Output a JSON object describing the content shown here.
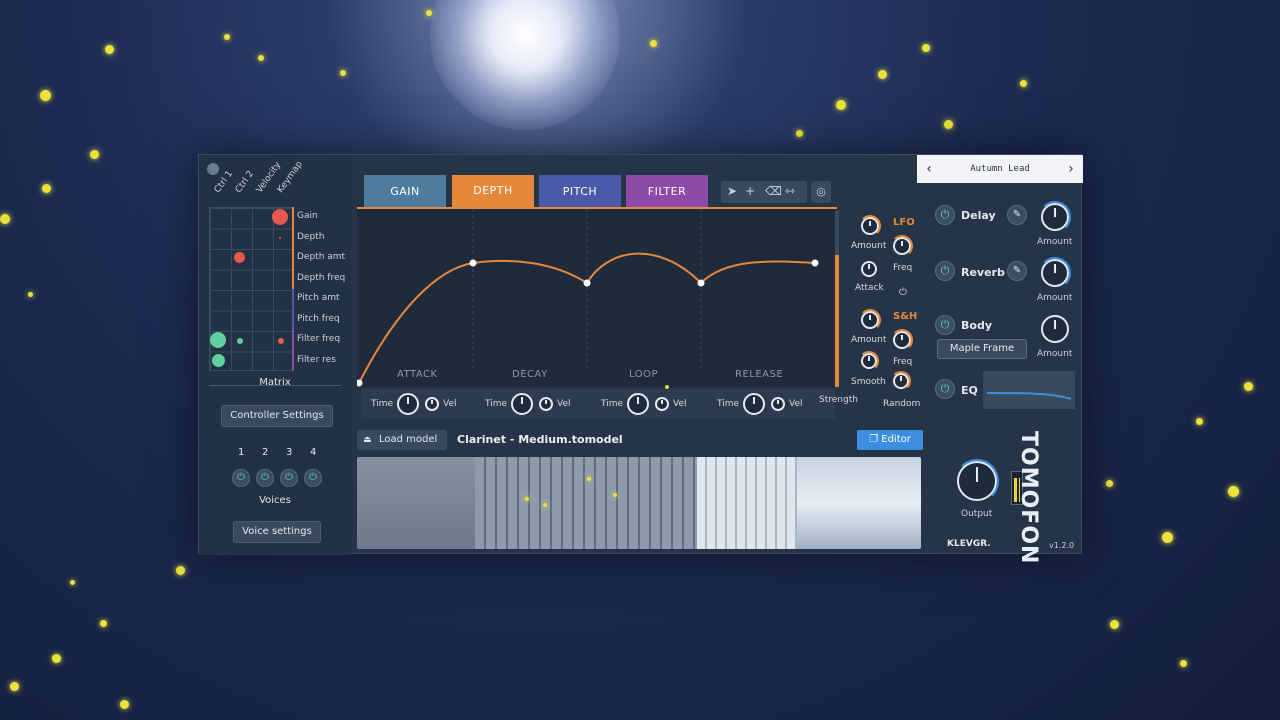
{
  "preset": {
    "name": "Autumn Lead"
  },
  "matrix": {
    "columns": [
      "Ctrl 1",
      "Ctrl 2",
      "Velocity",
      "Keymap"
    ],
    "rows": [
      "Gain",
      "Depth",
      "Depth amt",
      "Depth freq",
      "Pitch amt",
      "Pitch freq",
      "Filter freq",
      "Filter res"
    ],
    "title": "Matrix"
  },
  "controller_settings": "Controller Settings",
  "voices": {
    "numbers": [
      "1",
      "2",
      "3",
      "4"
    ],
    "label": "Voices",
    "settings_label": "Voice settings"
  },
  "tabs": [
    {
      "label": "GAIN"
    },
    {
      "label": "DEPTH"
    },
    {
      "label": "PITCH"
    },
    {
      "label": "FILTER"
    }
  ],
  "envelope": {
    "stages": [
      "ATTACK",
      "DECAY",
      "LOOP",
      "RELEASE"
    ],
    "time_label": "Time",
    "vel_label": "Vel"
  },
  "modulation": {
    "lfo_title": "LFO",
    "sh_title": "S&H",
    "amount": "Amount",
    "freq": "Freq",
    "attack": "Attack",
    "smooth": "Smooth",
    "strength": "Strength",
    "random": "Random"
  },
  "model": {
    "load_label": "Load model",
    "file": "Clarinet - Medium.tomodel",
    "editor_label": "Editor"
  },
  "effects": {
    "delay": "Delay",
    "reverb": "Reverb",
    "body": "Body",
    "body_preset": "Maple Frame",
    "eq": "EQ",
    "amount": "Amount",
    "output": "Output"
  },
  "brand": {
    "maker": "KLEVGR.",
    "product": "TOMOFON",
    "version": "v1.2.0"
  },
  "colors": {
    "depth_orange": "#e6883a",
    "gain_blue": "#4d7c9e",
    "pitch_indigo": "#4a5aa8",
    "filter_purple": "#8e4aa8",
    "accent_blue": "#3b8ee0"
  }
}
